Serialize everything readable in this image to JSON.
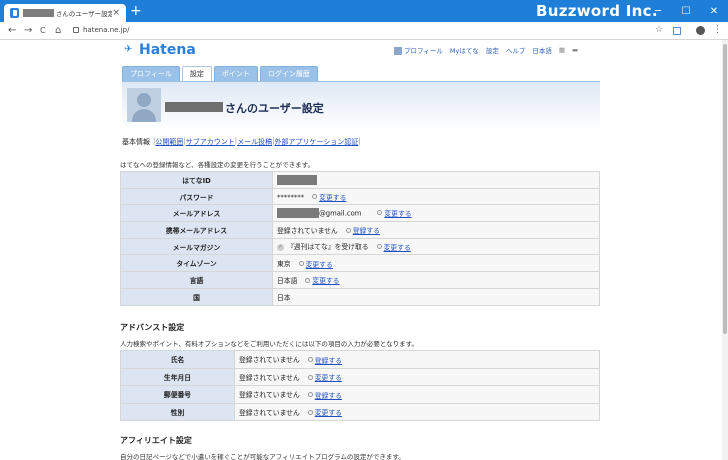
{
  "browser": {
    "tab_title": "さんのユーザー設定 - は",
    "tab_close": "×",
    "new_tab": "+",
    "brand": "Buzzword Inc.",
    "minimize": "─",
    "maximize": "☐",
    "close": "✕",
    "url": "hatena.ne.jp/",
    "back": "←",
    "forward": "→",
    "reload": "C",
    "home": "⌂",
    "star": "☆",
    "menu": "⋮"
  },
  "site": {
    "logo": "Hatena",
    "nav": [
      "プロフィール",
      "Myはてな",
      "設定",
      "ヘルプ",
      "日本語"
    ],
    "tabs": [
      "プロフィール",
      "設定",
      "ポイント",
      "ログイン履歴"
    ],
    "page_title": "さんのユーザー設定"
  },
  "subnav": {
    "current": "基本情報",
    "links": [
      "公開範囲",
      "サブアカウント",
      "メール投稿",
      "外部アプリケーション認証"
    ]
  },
  "intro": "はてなへの登録情報など、各種設定の変更を行うことができます。",
  "basic_rows": [
    {
      "label": "はてなID",
      "value": ""
    },
    {
      "label": "パスワード",
      "value": "********",
      "action": "変更する"
    },
    {
      "label": "メールアドレス",
      "value": "@gmail.com",
      "action": "変更する"
    },
    {
      "label": "携帯メールアドレス",
      "value": "登録されていません",
      "action": "登録する"
    },
    {
      "label": "メールマガジン",
      "value": "『週刊はてな』を受け取る",
      "action": "変更する"
    },
    {
      "label": "タイムゾーン",
      "value": "東京",
      "action": "変更する"
    },
    {
      "label": "言語",
      "value": "日本語",
      "action": "変更する"
    },
    {
      "label": "国",
      "value": "日本"
    }
  ],
  "advanced": {
    "title": "アドバンスト設定",
    "text": "人力検索やポイント、有料オプションなどをご利用いただくには以下の項目の入力が必要となります。",
    "rows": [
      {
        "label": "氏名",
        "value": "登録されていません",
        "action": "登録する"
      },
      {
        "label": "生年月日",
        "value": "登録されていません",
        "action": "変更する"
      },
      {
        "label": "郵便番号",
        "value": "登録されていません",
        "action": "登録する"
      },
      {
        "label": "性別",
        "value": "登録されていません",
        "action": "変更する"
      }
    ]
  },
  "affiliate": {
    "title": "アフィリエイト設定",
    "text": "自分の日記ページなどで小遣いを稼ぐことが可能なアフィリエイトプログラムの設定ができます。"
  }
}
